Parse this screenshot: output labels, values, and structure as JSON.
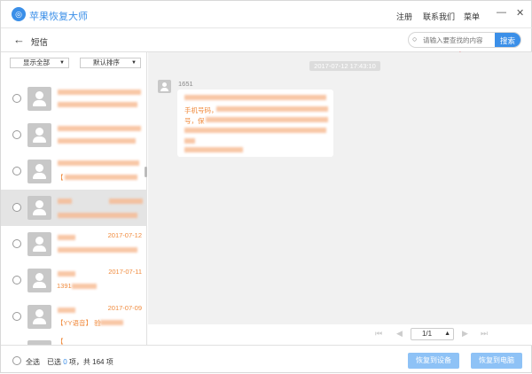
{
  "app": {
    "name": "苹果恢复大师",
    "menu": [
      "注册",
      "联系我们",
      "菜单"
    ]
  },
  "header": {
    "title": "短信",
    "search_placeholder": "请输入要查找的内容",
    "search_button": "搜索"
  },
  "filters": {
    "show": "显示全部",
    "sort": "默认排序"
  },
  "conversations": [
    {
      "date": "",
      "preview": ""
    },
    {
      "date": "",
      "preview": ""
    },
    {
      "date": "",
      "preview": "【"
    },
    {
      "date": "",
      "preview": ""
    },
    {
      "date": "2017-07-12",
      "preview": ""
    },
    {
      "date": "2017-07-11",
      "preview": "1391"
    },
    {
      "date": "2017-07-09",
      "preview": "【YY语音】 验"
    },
    {
      "date": "",
      "preview": "【"
    }
  ],
  "message": {
    "timestamp": "2017-07-12 17:43:10",
    "sender": "1651",
    "line1": "手机号码，",
    "line2": "号，保"
  },
  "pager": {
    "page": "1/1"
  },
  "footer": {
    "select_all": "全选",
    "selected_prefix": "已选",
    "selected": "0",
    "selected_suffix": "项，共 164 项",
    "restore_device": "恢复到设备",
    "restore_pc": "恢复到电脑"
  },
  "colors": {
    "accent": "#3b8fe8",
    "sms_text": "#f08a3c"
  }
}
